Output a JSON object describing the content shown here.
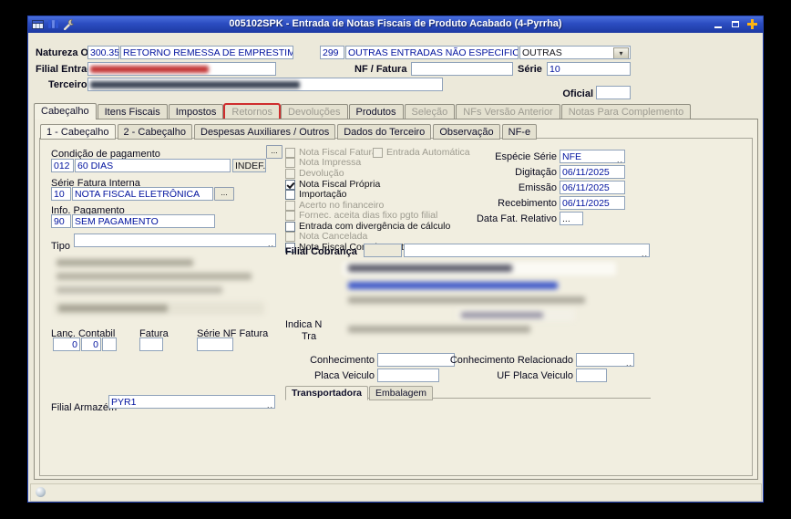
{
  "window": {
    "title": "005102SPK - Entrada de Notas Fiscais de Produto Acabado (4-Pyrrha)"
  },
  "colors": {
    "titlebar": "#2b4cc0",
    "highlight_red": "#cf2d2d",
    "value_blue": "#00129e",
    "window_bg": "#ece9da"
  },
  "icons": {
    "dropdown_arrow": "▾",
    "lookup_dots": "..",
    "ellipsis_button": "..."
  },
  "header": {
    "natureza_label": "Natureza Op.",
    "natureza_code": "300.35",
    "natureza_desc": "RETORNO REMESSA DE EMPRESTIMO",
    "cfop_code": "299",
    "cfop_desc": "OUTRAS ENTRADAS NÃO ESPECIFICA",
    "categoria_value": "OUTRAS",
    "filial_entrada_label": "Filial Entrada",
    "nf_fatura_label": "NF / Fatura",
    "nf_fatura_value": "",
    "serie_label": "Série",
    "serie_value": "10",
    "terceiro_label": "Terceiro",
    "oficial_label": "Oficial",
    "oficial_value": ""
  },
  "main_tabs": [
    {
      "label": "Cabeçalho",
      "active": true
    },
    {
      "label": "Itens Fiscais"
    },
    {
      "label": "Impostos"
    },
    {
      "label": "Retornos",
      "disabled": true,
      "highlighted": true
    },
    {
      "label": "Devoluções",
      "disabled": true
    },
    {
      "label": "Produtos"
    },
    {
      "label": "Seleção",
      "disabled": true
    },
    {
      "label": "NFs Versão Anterior",
      "disabled": true
    },
    {
      "label": "Notas Para Complemento",
      "disabled": true
    }
  ],
  "sub_tabs": [
    {
      "label": "1 - Cabeçalho",
      "active": true
    },
    {
      "label": "2 - Cabeçalho"
    },
    {
      "label": "Despesas Auxiliares / Outros"
    },
    {
      "label": "Dados do Terceiro"
    },
    {
      "label": "Observação"
    },
    {
      "label": "NF-e"
    }
  ],
  "left": {
    "condicao_label": "Condição de pagamento",
    "condicao_code": "012",
    "condicao_desc": "60 DIAS",
    "indef_label": "INDEF.",
    "serie_fatura_label": "Série Fatura Interna",
    "serie_fatura_code": "10",
    "serie_fatura_desc": "NOTA FISCAL ELETRÔNICA",
    "info_pagamento_label": "Info. Pagamento",
    "info_pagamento_code": "90",
    "info_pagamento_desc": "SEM PAGAMENTO",
    "tipo_label": "Tipo",
    "tipo_value": "",
    "lanc_contabil_label": "Lanç. Contabil",
    "fatura_label": "Fatura",
    "serie_nf_fatura_label": "Série NF Fatura",
    "lanc_value_1": "0",
    "lanc_value_2": "0",
    "filial_armazem_label": "Filial Armazém",
    "filial_armazem_value": "PYR1"
  },
  "checkboxes": [
    {
      "label": "Nota Fiscal Fatura",
      "checked": false,
      "disabled": true
    },
    {
      "label": "Entrada Automática",
      "checked": false,
      "disabled": true
    },
    {
      "label": "Nota Impressa",
      "checked": false,
      "disabled": true
    },
    {
      "label": "Devolução",
      "checked": false,
      "disabled": true
    },
    {
      "label": "Nota Fiscal Própria",
      "checked": true,
      "disabled": false
    },
    {
      "label": "Importação",
      "checked": false,
      "disabled": false
    },
    {
      "label": "Acerto no financeiro",
      "checked": false,
      "disabled": true
    },
    {
      "label": "Fornec. aceita dias fixo pgto filial",
      "checked": false,
      "disabled": true
    },
    {
      "label": "Entrada com divergência de cálculo",
      "checked": false,
      "disabled": false
    },
    {
      "label": "Nota Cancelada",
      "checked": false,
      "disabled": true
    },
    {
      "label": "Nota Fiscal Complementar",
      "checked": false,
      "disabled": false
    }
  ],
  "right": {
    "especie_serie_label": "Espécie Série",
    "especie_serie_value": "NFE",
    "digitacao_label": "Digitação",
    "digitacao_value": "06/11/2025",
    "emissao_label": "Emissão",
    "emissao_value": "06/11/2025",
    "recebimento_label": "Recebimento",
    "recebimento_value": "06/11/2025",
    "data_fat_relativo_label": "Data Fat. Relativo",
    "data_fat_relativo_value": "...",
    "filial_cobranca_label": "Filial Cobrança",
    "indica_fragment": "Indica N",
    "tra_fragment": "Tra",
    "conhecimento_label": "Conhecimento",
    "conhecimento_value": "",
    "conhecimento_relacionado_label": "Conhecimento Relacionado",
    "conhecimento_relacionado_value": "",
    "placa_veiculo_label": "Placa Veiculo",
    "placa_veiculo_value": "",
    "uf_placa_label": "UF Placa Veiculo",
    "uf_placa_value": "",
    "bottom_tabs": [
      {
        "label": "Transportadora",
        "active": true
      },
      {
        "label": "Embalagem"
      }
    ]
  }
}
